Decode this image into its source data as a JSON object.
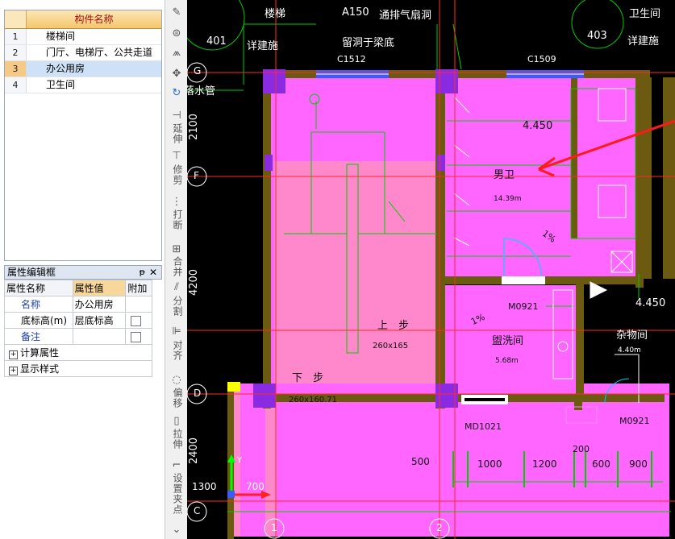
{
  "component_list": {
    "header": "构件名称",
    "rows": [
      {
        "index": "1",
        "name": "楼梯间"
      },
      {
        "index": "2",
        "name": "门厅、电梯厅、公共走道"
      },
      {
        "index": "3",
        "name": "办公用房"
      },
      {
        "index": "4",
        "name": "卫生间"
      }
    ],
    "selected_index": 2
  },
  "property_panel": {
    "title": "属性编辑框",
    "headers": {
      "name": "属性名称",
      "value": "属性值",
      "extra": "附加"
    },
    "rows": [
      {
        "name": "名称",
        "value": "办公用房"
      },
      {
        "name": "底标高(m)",
        "value": "层底标高"
      },
      {
        "name": "备注",
        "value": ""
      }
    ],
    "groups": [
      "计算属性",
      "显示样式"
    ]
  },
  "toolbar": {
    "labels": [
      "延伸",
      "修剪",
      "打断",
      "合并",
      "分割",
      "对齐",
      "偏移",
      "拉伸",
      "设置夹点"
    ]
  },
  "canvas": {
    "texts": {
      "stair_top": "楼梯",
      "a150": "A150",
      "vent": "通排气扇洞",
      "wc_top": "卫生间",
      "c401": "401",
      "c403": "403",
      "detail_left": "详建施",
      "detail_right": "详建施",
      "beam_hole": "留洞于梁底",
      "c1512": "C1512",
      "c1509": "C1509",
      "drain": "落水管",
      "elev_4450_a": "4.450",
      "elev_4450_b": "4.450",
      "mens_wc": "男卫",
      "mens_area": "14.39m",
      "slope_1": "1%",
      "slope_2": "1%",
      "m0921_a": "M0921",
      "m0921_b": "M0921",
      "wash": "盥洗间",
      "wash_area": "5.68m",
      "storage": "杂物间",
      "storage_area": "4.40m",
      "up": "上　步",
      "down": "下　步",
      "step_1": "260x165",
      "step_2": "260x160.71",
      "md1021": "MD1021",
      "dim_500": "500",
      "dim_1000": "1000",
      "dim_1200": "1200",
      "dim_200": "200",
      "dim_600": "600",
      "dim_900": "900",
      "dim_1300": "1300",
      "dim_700": "700",
      "dim_2100": "2100",
      "dim_4200": "4200",
      "dim_2400": "2400",
      "axis_g": "G",
      "axis_f": "F",
      "axis_d": "D",
      "axis_c": "C",
      "axis_1": "1",
      "axis_2": "2",
      "ucs_y": "Y"
    }
  },
  "colors": {
    "room_fill": "#ff66ff",
    "stair_fill": "#ff88cc",
    "wall": "#6b5a10",
    "column": "#8a2be2",
    "green_line": "#00cc00",
    "red_line": "#ff2a2a",
    "window": "#3b5bff"
  }
}
